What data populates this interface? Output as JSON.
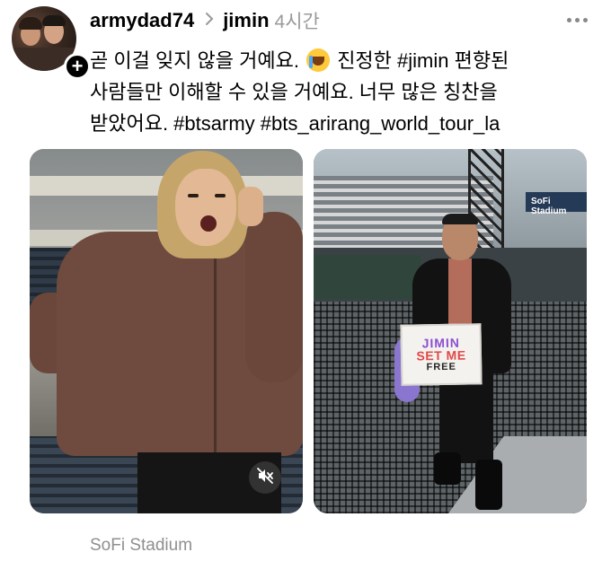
{
  "post": {
    "username": "armydad74",
    "tag": "jimin",
    "time": "4시간",
    "caption_lines": [
      {
        "before": "곧 이걸 잊지 않을 거예요. ",
        "after": " 진정한 #jimin 편향된"
      },
      "사람들만 이해할 수 있을 거예요. 너무 많은 칭찬을",
      "받았어요. #btsarmy #bts_arirang_world_tour_la"
    ],
    "photo_right": {
      "sign_line1": "JIMIN",
      "sign_line2": "SET ME",
      "sign_line3": "FREE",
      "screen_text": "SoFi Stadium"
    },
    "location": "SoFi Stadium"
  },
  "icons": {
    "follow": "plus-icon",
    "more": "more-dots-icon",
    "mute": "muted-speaker-icon",
    "chevron": "chevron-right-icon",
    "emoji": "crying-face-emoji-icon"
  }
}
